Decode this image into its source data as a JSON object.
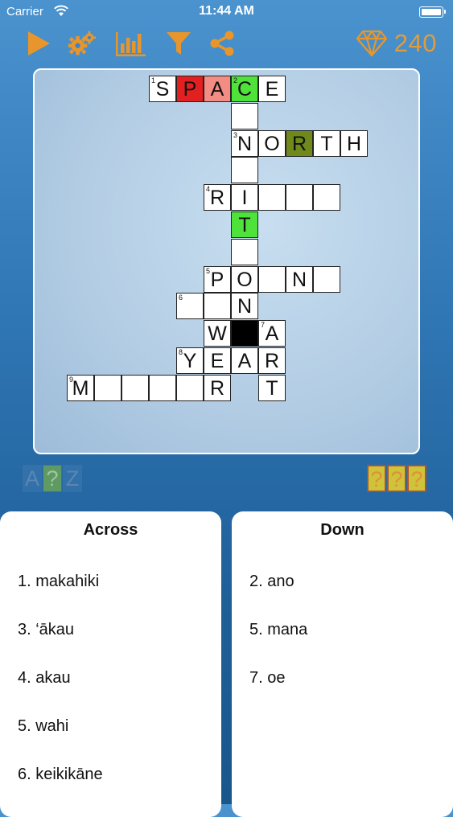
{
  "status": {
    "carrier": "Carrier",
    "time": "11:44 AM"
  },
  "toolbar": {
    "icons": [
      "play-icon",
      "gears-icon",
      "chart-icon",
      "filter-icon",
      "share-icon"
    ],
    "gems": "240",
    "accent": "#e29b3a"
  },
  "puzzle": {
    "cells": [
      {
        "r": 0,
        "c": 3,
        "n": "1",
        "l": "S",
        "fill": ""
      },
      {
        "r": 0,
        "c": 4,
        "l": "P",
        "fill": "red"
      },
      {
        "r": 0,
        "c": 5,
        "l": "A",
        "fill": "pink"
      },
      {
        "r": 0,
        "c": 6,
        "n": "2",
        "l": "C",
        "fill": "green"
      },
      {
        "r": 0,
        "c": 7,
        "l": "E",
        "fill": ""
      },
      {
        "r": 1,
        "c": 6,
        "l": "",
        "fill": ""
      },
      {
        "r": 2,
        "c": 6,
        "n": "3",
        "l": "N",
        "fill": ""
      },
      {
        "r": 2,
        "c": 7,
        "l": "O",
        "fill": ""
      },
      {
        "r": 2,
        "c": 8,
        "l": "R",
        "fill": "olive"
      },
      {
        "r": 2,
        "c": 9,
        "l": "T",
        "fill": ""
      },
      {
        "r": 2,
        "c": 10,
        "l": "H",
        "fill": ""
      },
      {
        "r": 3,
        "c": 6,
        "l": "",
        "fill": ""
      },
      {
        "r": 4,
        "c": 5,
        "n": "4",
        "l": "R",
        "fill": ""
      },
      {
        "r": 4,
        "c": 6,
        "l": "I",
        "fill": ""
      },
      {
        "r": 4,
        "c": 7,
        "l": "",
        "fill": ""
      },
      {
        "r": 4,
        "c": 8,
        "l": "",
        "fill": ""
      },
      {
        "r": 4,
        "c": 9,
        "l": "",
        "fill": ""
      },
      {
        "r": 5,
        "c": 6,
        "l": "T",
        "fill": "green"
      },
      {
        "r": 6,
        "c": 6,
        "l": "",
        "fill": ""
      },
      {
        "r": 7,
        "c": 5,
        "n": "5",
        "l": "P",
        "fill": ""
      },
      {
        "r": 7,
        "c": 6,
        "l": "O",
        "fill": ""
      },
      {
        "r": 7,
        "c": 7,
        "l": "",
        "fill": ""
      },
      {
        "r": 7,
        "c": 8,
        "l": "N",
        "fill": ""
      },
      {
        "r": 7,
        "c": 9,
        "l": "",
        "fill": ""
      },
      {
        "r": 8,
        "c": 4,
        "n": "6",
        "l": "",
        "fill": ""
      },
      {
        "r": 8,
        "c": 5,
        "l": "",
        "fill": ""
      },
      {
        "r": 8,
        "c": 6,
        "l": "N",
        "fill": ""
      },
      {
        "r": 9,
        "c": 5,
        "l": "W",
        "fill": ""
      },
      {
        "r": 9,
        "c": 6,
        "l": "",
        "fill": "black"
      },
      {
        "r": 9,
        "c": 7,
        "n": "7",
        "l": "A",
        "fill": ""
      },
      {
        "r": 10,
        "c": 4,
        "n": "8",
        "l": "Y",
        "fill": ""
      },
      {
        "r": 10,
        "c": 5,
        "l": "E",
        "fill": ""
      },
      {
        "r": 10,
        "c": 6,
        "l": "A",
        "fill": ""
      },
      {
        "r": 10,
        "c": 7,
        "l": "R",
        "fill": ""
      },
      {
        "r": 11,
        "c": 0,
        "n": "9",
        "l": "M",
        "fill": ""
      },
      {
        "r": 11,
        "c": 1,
        "l": "",
        "fill": ""
      },
      {
        "r": 11,
        "c": 2,
        "l": "",
        "fill": ""
      },
      {
        "r": 11,
        "c": 3,
        "l": "",
        "fill": ""
      },
      {
        "r": 11,
        "c": 4,
        "l": "",
        "fill": ""
      },
      {
        "r": 11,
        "c": 5,
        "l": "R",
        "fill": ""
      },
      {
        "r": 11,
        "c": 7,
        "l": "T",
        "fill": ""
      }
    ]
  },
  "hints": {
    "az": [
      "A",
      "?",
      "Z"
    ],
    "qq": [
      "?",
      "?",
      "?"
    ]
  },
  "across": {
    "title": "Across",
    "clues": [
      "1. makahiki",
      "3. ‘ākau",
      "4. akau",
      "5. wahi",
      "6. keikikāne"
    ]
  },
  "down": {
    "title": "Down",
    "clues": [
      "2. ano",
      "5. mana",
      "7. oe"
    ]
  }
}
